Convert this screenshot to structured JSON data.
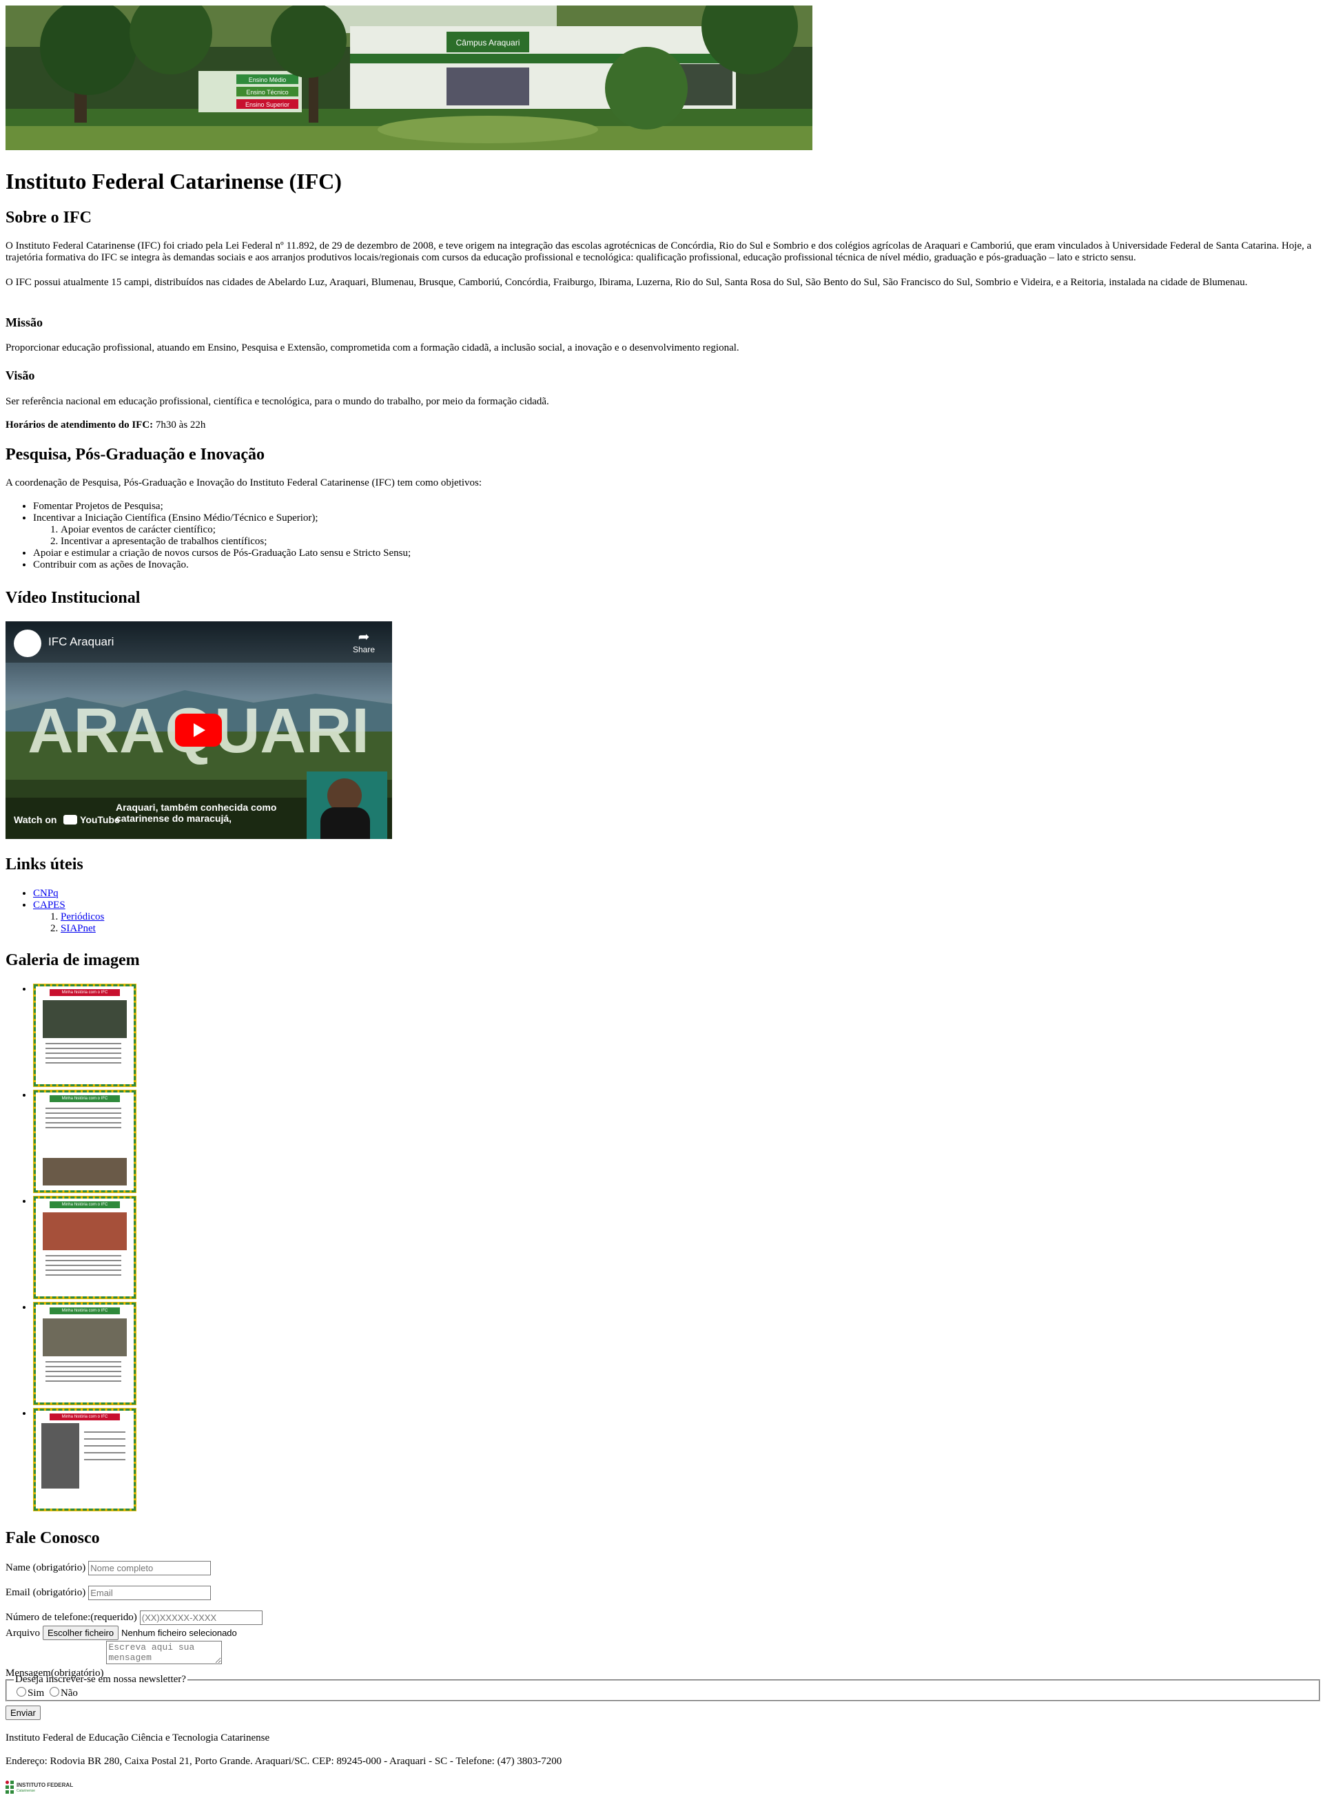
{
  "header": {
    "title": "Instituto Federal Catarinense (IFC)"
  },
  "banner": {
    "sign_title": "Câmpus Araquari",
    "board_lines": [
      "Ensino Médio",
      "Ensino Técnico",
      "Ensino Superior"
    ]
  },
  "sobre": {
    "heading": "Sobre o IFC",
    "p1": "O Instituto Federal Catarinense (IFC) foi criado pela Lei Federal nº 11.892, de 29 de dezembro de 2008, e teve origem na integração das escolas agrotécnicas de Concórdia, Rio do Sul e Sombrio e dos colégios agrícolas de Araquari e Camboriú, que eram vinculados à Universidade Federal de Santa Catarina. Hoje, a trajetória formativa do IFC se integra às demandas sociais e aos arranjos produtivos locais/regionais com cursos da educação profissional e tecnológica: qualificação profissional, educação profissional técnica de nível médio, graduação e pós-graduação – lato e stricto sensu.",
    "p2": "O IFC possui atualmente 15 campi, distribuídos nas cidades de Abelardo Luz, Araquari, Blumenau, Brusque, Camboriú, Concórdia, Fraiburgo, Ibirama, Luzerna, Rio do Sul, Santa Rosa do Sul, São Bento do Sul, São Francisco do Sul, Sombrio e Videira, e a Reitoria, instalada na cidade de Blumenau.",
    "missao_heading": "Missão",
    "missao": "Proporcionar educação profissional, atuando em Ensino, Pesquisa e Extensão, comprometida com a formação cidadã, a inclusão social, a inovação e o desenvolvimento regional.",
    "visao_heading": "Visão",
    "visao": "Ser referência nacional em educação profissional, científica e tecnológica, para o mundo do trabalho, por meio da formação cidadã.",
    "horarios_label": "Horários de atendimento do IFC:",
    "horarios_value": " 7h30 às 22h"
  },
  "pesquisa": {
    "heading": "Pesquisa, Pós-Graduação e Inovação",
    "intro": "A coordenação de Pesquisa, Pós-Graduação e Inovação do Instituto Federal Catarinense (IFC) tem como objetivos:",
    "items": [
      "Fomentar Projetos de Pesquisa;",
      "Incentivar a Iniciação Científica (Ensino Médio/Técnico e Superior);",
      "Apoiar e estimular a criação de novos cursos de Pós-Graduação Lato sensu e Stricto Sensu;",
      "Contribuir com as ações de Inovação."
    ],
    "subitems": [
      "Apoiar eventos de carácter científico;",
      "Incentivar a apresentação de trabalhos científicos;"
    ]
  },
  "video": {
    "heading": "Vídeo Institucional",
    "channel": "IFC Araquari",
    "share": "Share",
    "big_text": "ARAQUARI",
    "caption_line1": "Araquari, também conhecida como",
    "caption_line2": "catarinense do maracujá,",
    "watch_on": "Watch on",
    "youtube": "YouTube"
  },
  "links": {
    "heading": "Links úteis",
    "items": [
      "CNPq",
      "CAPES"
    ],
    "subitems": [
      "Periódicos",
      "SIAPnet"
    ]
  },
  "galeria": {
    "heading": "Galeria de imagem",
    "tag": "Minha história com o IFC"
  },
  "contato": {
    "heading": "Fale Conosco",
    "name_label": "Name (obrigatório)",
    "name_placeholder": "Nome completo",
    "email_label": "Email (obrigatório)",
    "email_placeholder": "Email",
    "phone_label": "Número de telefone:(requerido)",
    "phone_placeholder": "(XX)XXXXX-XXXX",
    "file_label": "Arquivo",
    "file_button": "Escolher ficheiro",
    "file_status": "Nenhum ficheiro selecionado",
    "message_label": "Mensagem(obrigatório)",
    "message_placeholder": "Escreva aqui sua mensagem",
    "newsletter_legend": "Deseja inscrever-se em nossa newsletter?",
    "option_yes": "Sim",
    "option_no": "Não",
    "submit": "Enviar"
  },
  "footer": {
    "line1": "Instituto Federal de Educação Ciência e Tecnologia Catarinense",
    "line2": "Endereço: Rodovia BR 280, Caixa Postal 21, Porto Grande. Araquari/SC. CEP: 89245-000 - Araquari - SC - Telefone: (47) 3803-7200",
    "logo_text": "INSTITUTO FEDERAL",
    "logo_sub": "Catarinense"
  },
  "colors": {
    "ifc_green": "#2f8a3b",
    "ifc_red": "#c8102e",
    "link": "#0000ee"
  }
}
